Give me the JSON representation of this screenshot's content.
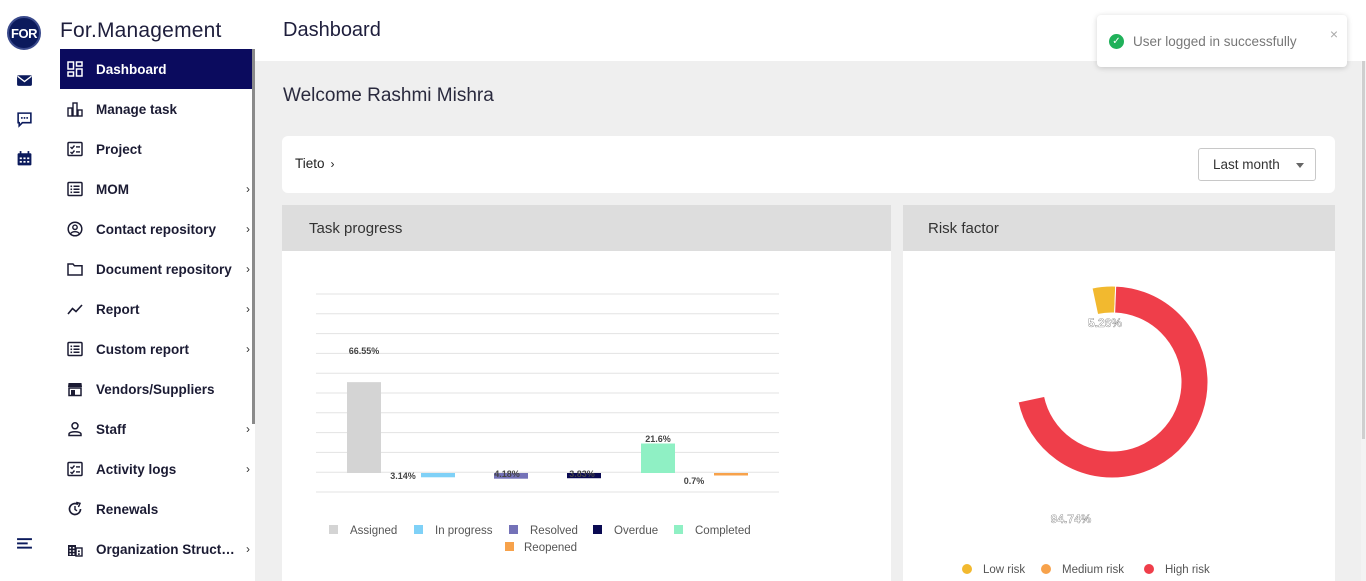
{
  "app": {
    "logo_text": "FOR",
    "brand": "For.Management"
  },
  "rail": {
    "icons": [
      "mail-icon",
      "chat-icon",
      "calendar-icon",
      "menu-icon"
    ]
  },
  "sidebar": {
    "items": [
      {
        "label": "Dashboard",
        "icon": "dashboard-icon",
        "active": true,
        "has_submenu": false
      },
      {
        "label": "Manage task",
        "icon": "bar-chart-icon",
        "active": false,
        "has_submenu": false
      },
      {
        "label": "Project",
        "icon": "checklist-icon",
        "active": false,
        "has_submenu": false
      },
      {
        "label": "MOM",
        "icon": "list-icon",
        "active": false,
        "has_submenu": true
      },
      {
        "label": "Contact repository",
        "icon": "contact-icon",
        "active": false,
        "has_submenu": true
      },
      {
        "label": "Document repository",
        "icon": "folder-icon",
        "active": false,
        "has_submenu": true
      },
      {
        "label": "Report",
        "icon": "trend-icon",
        "active": false,
        "has_submenu": true
      },
      {
        "label": "Custom report",
        "icon": "list-icon",
        "active": false,
        "has_submenu": true
      },
      {
        "label": "Vendors/Suppliers",
        "icon": "store-icon",
        "active": false,
        "has_submenu": false
      },
      {
        "label": "Staff",
        "icon": "person-icon",
        "active": false,
        "has_submenu": true
      },
      {
        "label": "Activity logs",
        "icon": "checklist-icon",
        "active": false,
        "has_submenu": true
      },
      {
        "label": "Renewals",
        "icon": "renew-icon",
        "active": false,
        "has_submenu": false
      },
      {
        "label": "Organization Struct…",
        "icon": "building-icon",
        "active": false,
        "has_submenu": true
      }
    ]
  },
  "header": {
    "title": "Dashboard"
  },
  "main": {
    "welcome": "Welcome Rashmi Mishra",
    "breadcrumb": "Tieto",
    "period": "Last month"
  },
  "toast": {
    "message": "User logged in successfully"
  },
  "colors": {
    "accent": "#0b0b5e",
    "assigned": "#d4d4d4",
    "in_progress": "#7fd1f7",
    "resolved": "#7472b8",
    "overdue": "#0a0a52",
    "completed": "#8ff0c4",
    "reopened": "#f7a24b",
    "low_risk": "#f2b92f",
    "medium_risk": "#f7a24b",
    "high_risk": "#ef3e4a"
  },
  "chart_data": [
    {
      "type": "bar",
      "title": "Task progress",
      "categories": [
        "Assigned",
        "In progress",
        "Resolved",
        "Overdue",
        "Completed",
        "Reopened"
      ],
      "values": [
        66.55,
        -3.14,
        -4.18,
        -3.83,
        21.6,
        -0.7
      ],
      "labels": [
        "66.55%",
        "3.14%",
        "4.18%",
        "3.83%",
        "21.6%",
        "0.7%"
      ],
      "legend": [
        "Assigned",
        "In progress",
        "Resolved",
        "Overdue",
        "Completed",
        "Reopened"
      ],
      "legend_position": "bottom",
      "grid": true
    },
    {
      "type": "pie",
      "title": "Risk factor",
      "categories": [
        "Low risk",
        "Medium risk",
        "High risk"
      ],
      "values": [
        5.26,
        0,
        94.74
      ],
      "labels": [
        "5.26%",
        "94.74%"
      ],
      "legend_position": "bottom"
    }
  ]
}
